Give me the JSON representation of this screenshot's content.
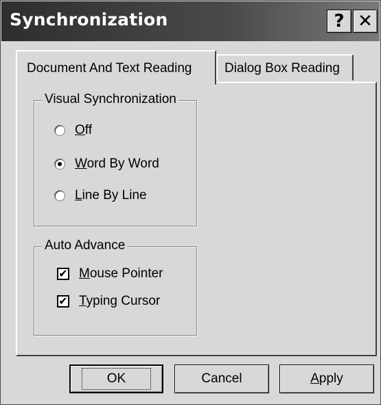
{
  "window": {
    "title": "Synchronization",
    "help_glyph": "?",
    "close_glyph": "✕"
  },
  "tabs": [
    {
      "label": "Document And Text Reading",
      "active": true
    },
    {
      "label": "Dialog Box Reading",
      "active": false
    }
  ],
  "visual_sync": {
    "legend": "Visual Synchronization",
    "options": [
      {
        "mnemonic": "O",
        "rest": "ff",
        "checked": false
      },
      {
        "mnemonic": "W",
        "rest": "ord By Word",
        "checked": true
      },
      {
        "mnemonic": "L",
        "rest": "ine By Line",
        "checked": false
      }
    ]
  },
  "auto_advance": {
    "legend": "Auto Advance",
    "options": [
      {
        "mnemonic": "M",
        "rest": "ouse Pointer",
        "checked": true
      },
      {
        "mnemonic": "T",
        "rest": "yping Cursor",
        "checked": true
      }
    ]
  },
  "check_glyph": "✔",
  "buttons": {
    "ok": "OK",
    "cancel": "Cancel",
    "apply_mnemonic": "A",
    "apply_rest": "pply"
  }
}
